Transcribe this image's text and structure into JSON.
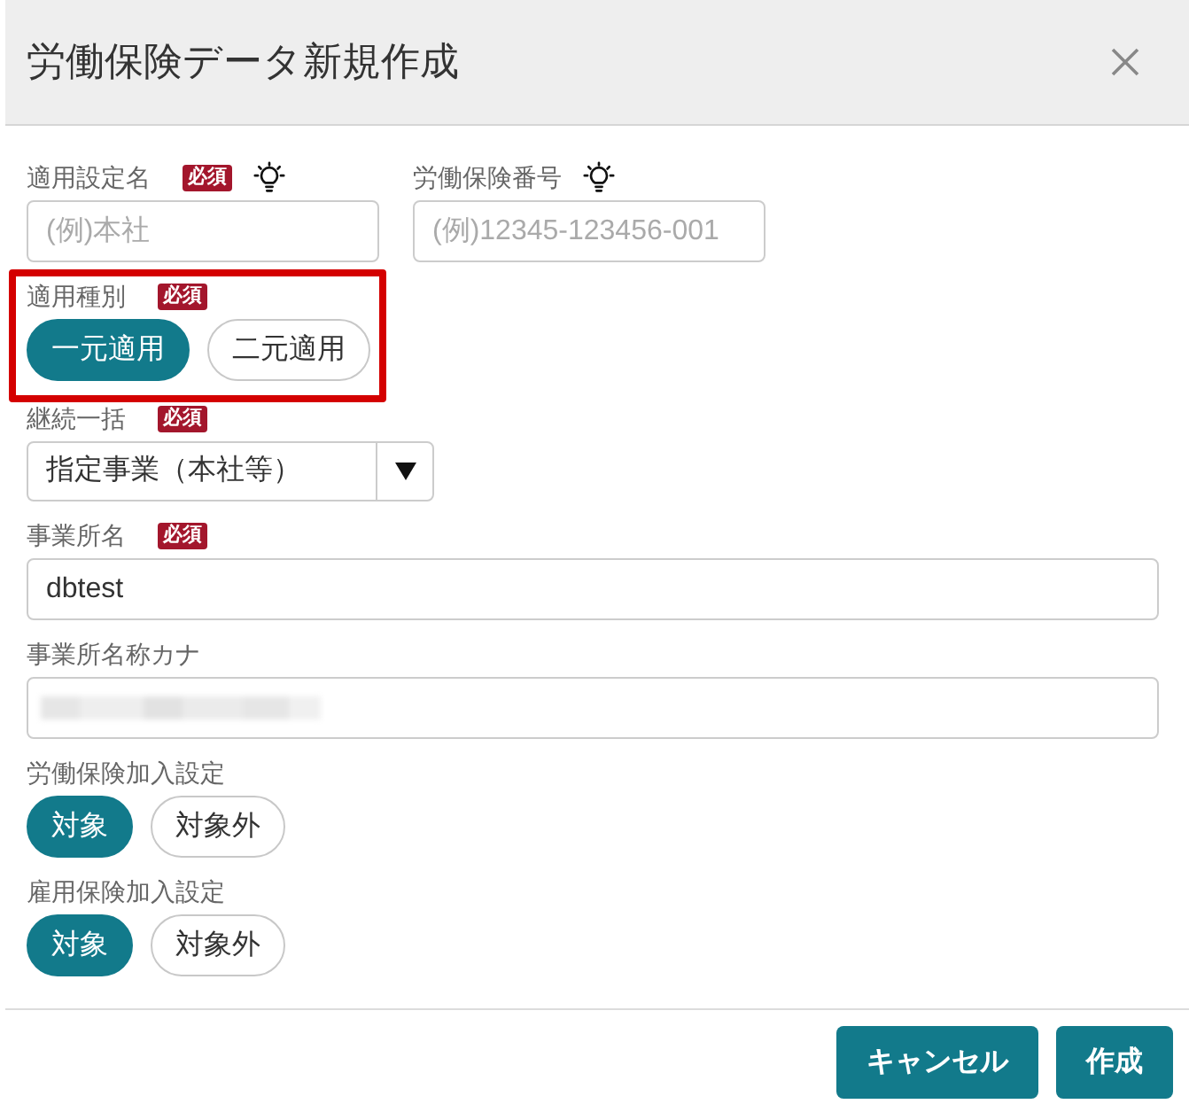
{
  "dialog": {
    "title": "労働保険データ新規作成"
  },
  "form": {
    "rows": [
      {
        "fields": [
          {
            "kind": "text",
            "label": "適用設定名",
            "badge": "必須",
            "hint": true,
            "placeholder": "(例)本社"
          },
          {
            "kind": "text",
            "label": "労働保険番号",
            "hint": true,
            "placeholder": "(例)12345-123456-001"
          }
        ]
      },
      {
        "fields": [
          {
            "kind": "toggle",
            "label": "適用種別",
            "badge": "必須",
            "highlighted": true,
            "options": [
              {
                "label": "一元適用",
                "selected": true
              },
              {
                "label": "二元適用",
                "selected": false
              }
            ]
          }
        ]
      },
      {
        "fields": [
          {
            "kind": "select",
            "label": "継続一括",
            "badge": "必須",
            "value": "指定事業（本社等）"
          }
        ]
      },
      {
        "fields": [
          {
            "kind": "text",
            "label": "事業所名",
            "badge": "必須",
            "value": "dbtest"
          }
        ]
      },
      {
        "fields": [
          {
            "kind": "text",
            "label": "事業所名称カナ",
            "value_redacted": true
          }
        ]
      },
      {
        "fields": [
          {
            "kind": "toggle",
            "label": "労働保険加入設定",
            "options": [
              {
                "label": "対象",
                "selected": true
              },
              {
                "label": "対象外",
                "selected": false
              }
            ]
          }
        ]
      },
      {
        "fields": [
          {
            "kind": "toggle",
            "label": "雇用保険加入設定",
            "options": [
              {
                "label": "対象",
                "selected": true
              },
              {
                "label": "対象外",
                "selected": false
              }
            ]
          }
        ]
      }
    ]
  },
  "footer": {
    "buttons": [
      {
        "label": "キャンセル"
      },
      {
        "label": "作成"
      }
    ]
  }
}
